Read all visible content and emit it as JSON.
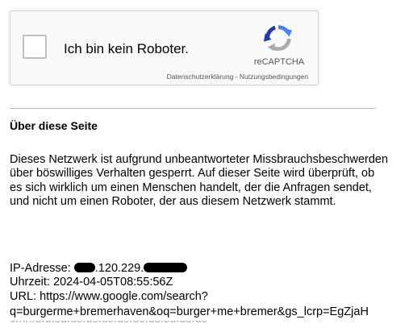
{
  "captcha": {
    "checkbox_label": "Ich bin kein Roboter.",
    "brand": "reCAPTCHA",
    "privacy_link": "Datenschutzerklärung",
    "separator": " - ",
    "terms_link": "Nutzungsbedingungen",
    "checked": false
  },
  "about": {
    "title": "Über diese Seite",
    "paragraph": "Dieses Netzwerk ist aufgrund unbeantworteter Missbrauchsbeschwerden über böswilliges Verhalten gesperrt. Auf dieser Seite wird überprüft, ob es sich wirklich um einen Menschen handelt, der die Anfragen sendet, und nicht um einen Roboter, der aus diesem Netzwerk stammt."
  },
  "info": {
    "ip_label": "IP-Adresse: ",
    "ip_visible_1": ".120.229.",
    "time_label": "Uhrzeit: ",
    "time_value": "2024-04-05T08:55:56Z",
    "url_label": "URL: ",
    "url_value": "https://www.google.com/search?",
    "url_query": "q=burgerme+bremerhaven&oq=burger+me+bremer&gs_lcrp=EgZjaH",
    "url_query_next": "cmhfdfdfsdfdsfdsfdsfdsfdsfdsfsdfdsfds"
  },
  "colors": {
    "recaptcha_blue_dark": "#1c3aa9",
    "recaptcha_blue": "#4285f4",
    "recaptcha_grey": "#ababab"
  }
}
